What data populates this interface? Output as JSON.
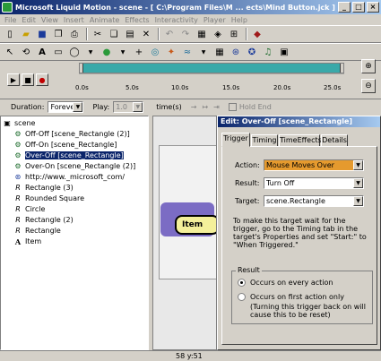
{
  "window": {
    "title": "Microsoft Liquid Motion - scene - [ C:\\Program Files\\M ... ects\\Mind Button.jck ]"
  },
  "menu": [
    "File",
    "Edit",
    "View",
    "Insert",
    "Animate",
    "Effects",
    "Interactivity",
    "Player",
    "Help"
  ],
  "timeline": {
    "ticks": [
      "0.0s",
      "5.0s",
      "10.0s",
      "15.0s",
      "20.0s",
      "25.0s"
    ],
    "duration_label": "Duration:",
    "duration_value": "Forever",
    "play_label": "Play:",
    "play_value": "1.0",
    "times_label": "time(s)",
    "hold_end_label": "Hold End"
  },
  "tree": {
    "items": [
      {
        "label": "scene",
        "icon": "scene-icon"
      },
      {
        "label": "Off-Off [scene_Rectangle (2)]",
        "icon": "action-icon"
      },
      {
        "label": "Off-On [scene_Rectangle]",
        "icon": "action-icon"
      },
      {
        "label": "Over-Off [scene_Rectangle]",
        "icon": "action-icon"
      },
      {
        "label": "Over-On [scene_Rectangle (2)]",
        "icon": "action-icon"
      },
      {
        "label": "http://www._microsoft_com/",
        "icon": "link-icon"
      },
      {
        "label": "Rectangle (3)",
        "icon": "shape-icon"
      },
      {
        "label": "Rounded Square",
        "icon": "shape-icon"
      },
      {
        "label": "Circle",
        "icon": "shape-icon"
      },
      {
        "label": "Rectangle (2)",
        "icon": "shape-icon"
      },
      {
        "label": "Rectangle",
        "icon": "shape-icon"
      },
      {
        "label": "Item",
        "icon": "text-icon"
      }
    ]
  },
  "stage": {
    "button_text": "Item"
  },
  "dialog": {
    "title": "Edit: Over-Off [scene_Rectangle]",
    "tabs": [
      "Trigger",
      "Timing",
      "TimeEffects",
      "Details"
    ],
    "action_label": "Action:",
    "action_value": "Mouse Moves Over",
    "result_label": "Result:",
    "result_value": "Turn Off",
    "target_label": "Target:",
    "target_value": "scene.Rectangle",
    "help_text": "To make this target wait for the trigger, go to the Timing tab in the target's Properties and set \"Start:\" to \"When Triggered.\"",
    "group_title": "Result",
    "option1": "Occurs on every action",
    "option2": "Occurs on first action only",
    "option2_note": "(Turning this trigger back on will cause this to be reset)"
  },
  "status": {
    "coords": "58  y:51"
  }
}
